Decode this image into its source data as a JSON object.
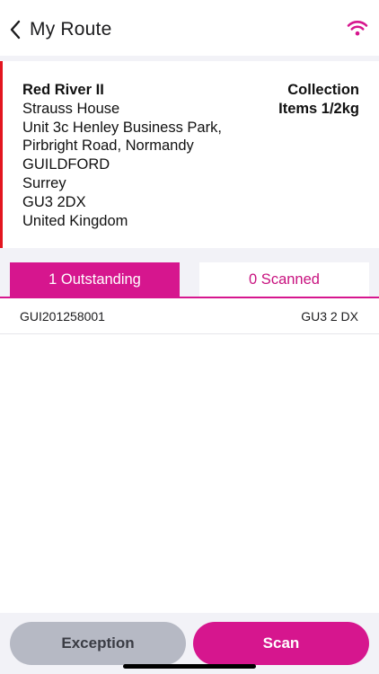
{
  "header": {
    "title": "My Route",
    "back_icon": "chevron-left-icon",
    "status_icon": "wifi-icon"
  },
  "address": {
    "name": "Red River II",
    "lines": [
      "Strauss House",
      "Unit 3c Henley Business Park,",
      "Pirbright Road, Normandy",
      "GUILDFORD",
      "Surrey",
      "GU3 2DX",
      "United Kingdom"
    ],
    "type": "Collection",
    "items": "Items 1/2kg"
  },
  "tabs": [
    {
      "label": "1 Outstanding",
      "active": true
    },
    {
      "label": "0 Scanned",
      "active": false
    }
  ],
  "list": [
    {
      "code": "GUI201258001",
      "postcode": "GU3 2 DX"
    }
  ],
  "actions": {
    "exception_label": "Exception",
    "scan_label": "Scan"
  },
  "colors": {
    "accent": "#d6168e",
    "alert_border": "#e3151f",
    "secondary_button": "#b6b9c4",
    "background": "#f2f2f7"
  }
}
